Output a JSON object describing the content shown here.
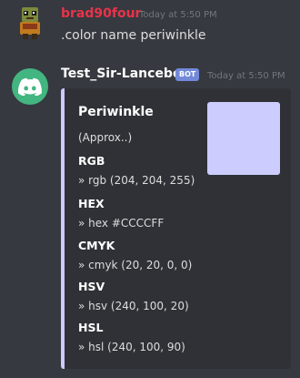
{
  "message1": {
    "username": "brad90four",
    "timestamp": "Today at 5:50 PM",
    "text": ".color name periwinkle",
    "avatar_icon": "minecraft-character-avatar"
  },
  "message2": {
    "username": "Test_Sir-Lancebot",
    "badge": "BOT",
    "timestamp": "Today at 5:50 PM",
    "avatar_icon": "discord-logo-icon",
    "embed": {
      "accent_color": "#ccccff",
      "title": "Periwinkle",
      "description": "(Approx..)",
      "thumbnail_color": "#ccccff",
      "fields": [
        {
          "name": "RGB",
          "value": "» rgb (204, 204, 255)"
        },
        {
          "name": "HEX",
          "value": "» hex #CCCCFF"
        },
        {
          "name": "CMYK",
          "value": "» cmyk (20, 20, 0, 0)"
        },
        {
          "name": "HSV",
          "value": "» hsv (240, 100, 20)"
        },
        {
          "name": "HSL",
          "value": "» hsl (240, 100, 90)"
        }
      ]
    }
  },
  "colors": {
    "background": "#36393f",
    "embed_background": "#2f3136",
    "username1": "#e8334a",
    "bot_avatar": "#43b581",
    "bot_badge": "#7289da"
  }
}
